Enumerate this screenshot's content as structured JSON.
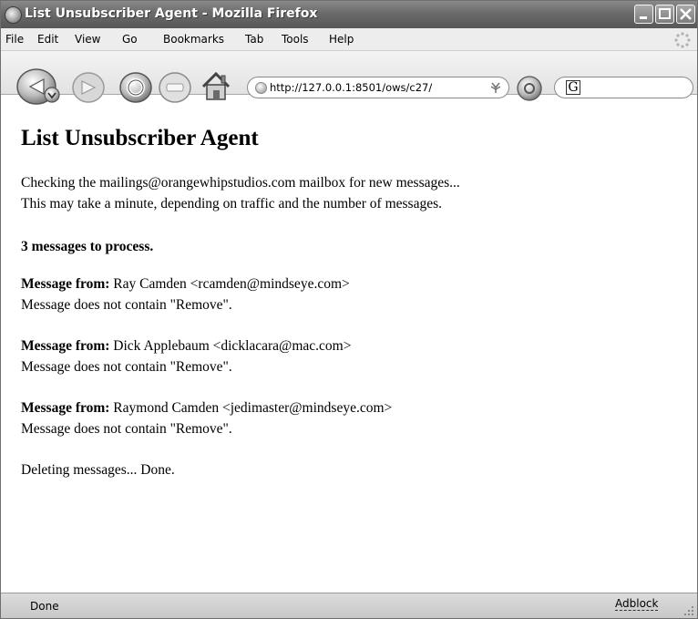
{
  "window": {
    "title": "List Unsubscriber Agent - Mozilla Firefox"
  },
  "menu": {
    "items": [
      "File",
      "Edit",
      "View",
      "Go",
      "Bookmarks",
      "Tab",
      "Tools",
      "Help"
    ]
  },
  "toolbar": {
    "url": "http://127.0.0.1:8501/ows/c27/",
    "search_engine_glyph": "G"
  },
  "page": {
    "heading": "List Unsubscriber Agent",
    "intro_line1": "Checking the mailings@orangewhipstudios.com mailbox for new messages...",
    "intro_line2": "This may take a minute, depending on traffic and the number of messages.",
    "count_text": "3 messages to process.",
    "messages": [
      {
        "label": "Message from:",
        "from": "Ray Camden <rcamden@mindseye.com>",
        "result": "Message does not contain \"Remove\"."
      },
      {
        "label": "Message from:",
        "from": "Dick Applebaum <dicklacara@mac.com>",
        "result": "Message does not contain \"Remove\"."
      },
      {
        "label": "Message from:",
        "from": "Raymond Camden <jedimaster@mindseye.com>",
        "result": "Message does not contain \"Remove\"."
      }
    ],
    "deleting_text": "Deleting messages... Done."
  },
  "statusbar": {
    "status": "Done",
    "adblock": "Adblock"
  }
}
